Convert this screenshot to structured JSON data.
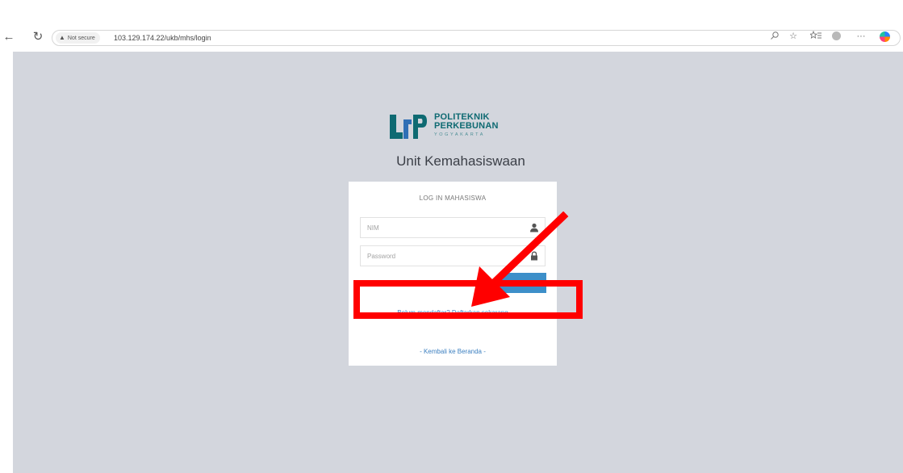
{
  "browser": {
    "back_icon": "←",
    "reload_icon": "↻",
    "security_label": "Not secure",
    "url": "103.129.174.22/ukb/mhs/login",
    "toolbar_icons": [
      "read-aloud-icon",
      "favorite-icon",
      "favorites-list-icon",
      "profile-icon",
      "more-icon",
      "copilot-icon"
    ]
  },
  "logo": {
    "line1": "POLITEKNIK",
    "line2": "PERKEBUNAN",
    "line3": "YOGYAKARTA",
    "colors": {
      "teal": "#0e6a72",
      "blue": "#2f6fb5"
    }
  },
  "page": {
    "title": "Unit Kemahasiswaan",
    "background": "#d3d6dd"
  },
  "login_form": {
    "heading": "LOG IN MAHASISWA",
    "nim": {
      "placeholder": "NIM",
      "value": ""
    },
    "password": {
      "placeholder": "Password",
      "value": ""
    },
    "submit_label": "",
    "submit_color": "#3d8fc9",
    "register_prompt": "Belum mendaftar? Daftarkan sekarang",
    "back_link": "- Kembali ke Beranda -"
  },
  "annotation": {
    "color": "#ff0000",
    "shapes": [
      "arrow",
      "rectangle"
    ]
  }
}
